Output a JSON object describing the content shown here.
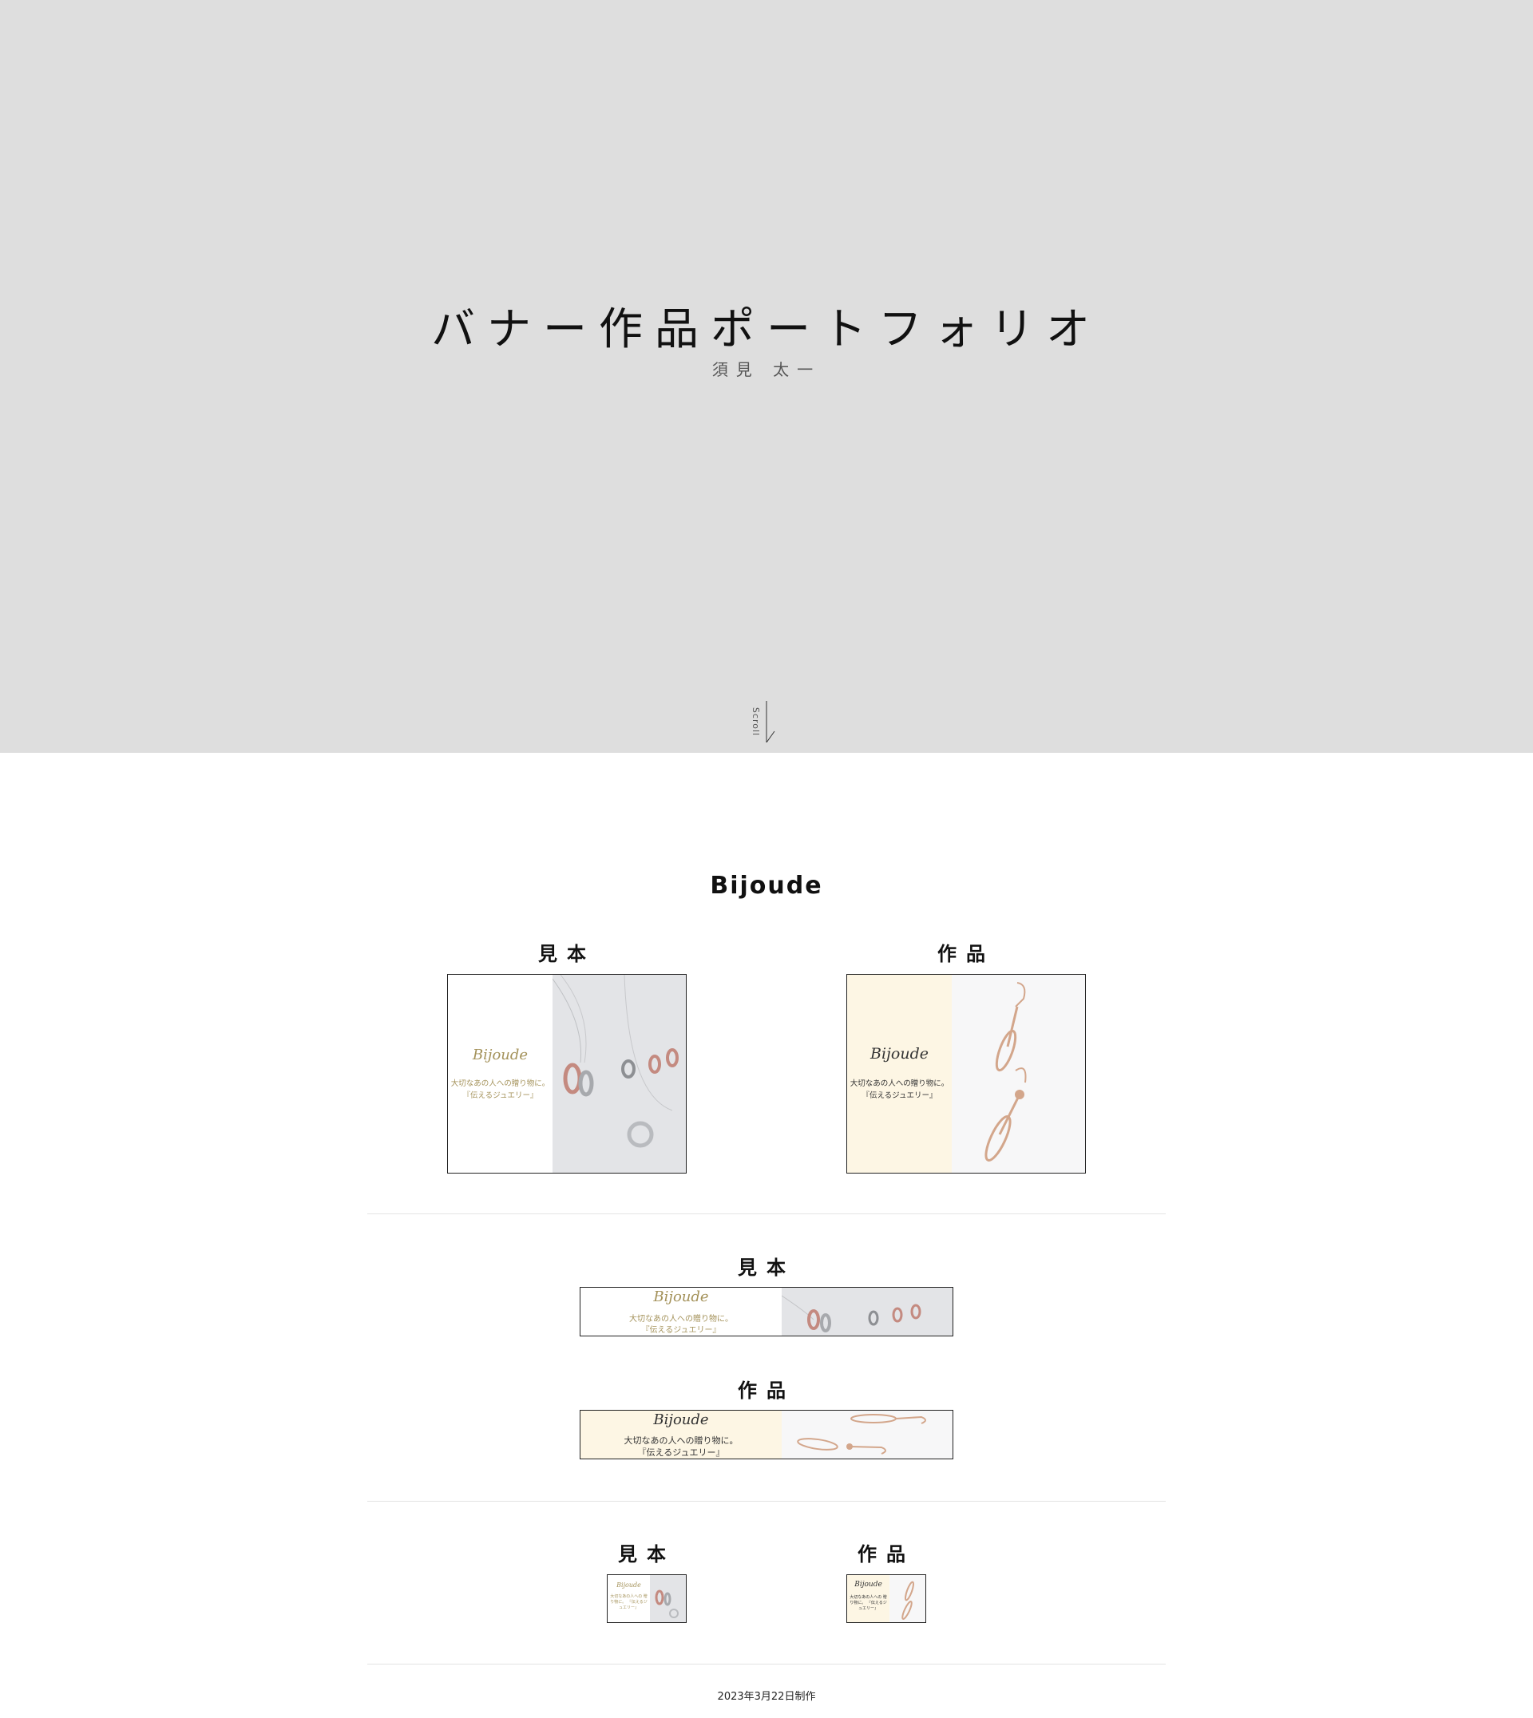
{
  "hero": {
    "title": "バナー作品ポートフォリオ",
    "subtitle": "須見 太一",
    "scroll_label": "Scroll"
  },
  "section": {
    "title": "Bijoude",
    "rows": [
      {
        "sample_label": "見本",
        "work_label": "作品"
      },
      {
        "sample_label": "見本",
        "work_label": "作品"
      },
      {
        "sample_label": "見本",
        "work_label": "作品"
      }
    ]
  },
  "banners": {
    "logo": "Bijoude",
    "copy_line1": "大切なあの人への贈り物に。",
    "copy_line2": "『伝えるジュエリー』",
    "square_sample_copy": "大切なあの人への 贈り物に。 『伝えるジュエリー』",
    "colors": {
      "sample_bg": "#ffffff",
      "work_bg": "#fdf6e4",
      "gold": "#a4925a",
      "photo_bg": "#e2e3e6"
    }
  },
  "footer": {
    "text": "2023年3月22日制作"
  }
}
